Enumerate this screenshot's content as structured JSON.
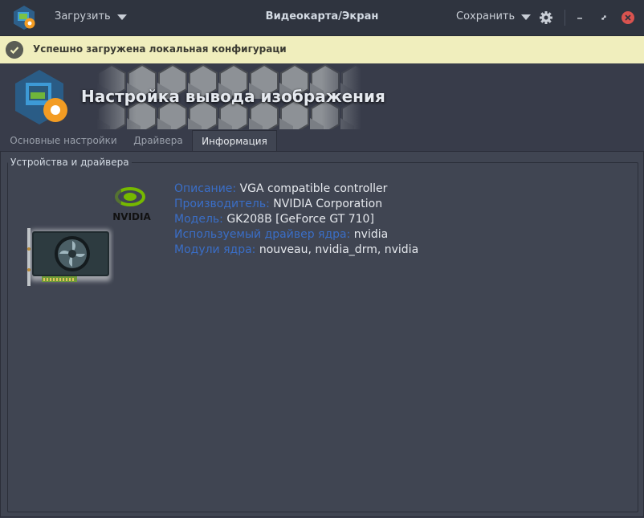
{
  "titlebar": {
    "load_label": "Загрузить",
    "title": "Видеокарта/Экран",
    "save_label": "Сохранить"
  },
  "infobar": {
    "message": "Успешно загружена локальная конфигураци"
  },
  "banner": {
    "title": "Настройка вывода изображения"
  },
  "tabs": [
    {
      "label": "Основные настройки",
      "active": false
    },
    {
      "label": "Драйвера",
      "active": false
    },
    {
      "label": "Информация",
      "active": true
    }
  ],
  "group": {
    "title": "Устройства и драйвера"
  },
  "device": {
    "vendor_logo_text": "NVIDIA",
    "fields": [
      {
        "label": "Описание:",
        "value": "VGA compatible controller"
      },
      {
        "label": "Производитель:",
        "value": "NVIDIA Corporation"
      },
      {
        "label": "Модель:",
        "value": "GK208B [GeForce GT 710]"
      },
      {
        "label": "Используемый драйвер ядра:",
        "value": "nvidia"
      },
      {
        "label": "Модули ядра:",
        "value": "nouveau, nvidia_drm, nvidia"
      }
    ]
  },
  "colors": {
    "accent_label": "#3a6ec7",
    "infobar_bg": "#f0eebd",
    "close_button": "#d9534f",
    "nvidia_green": "#76b900"
  }
}
